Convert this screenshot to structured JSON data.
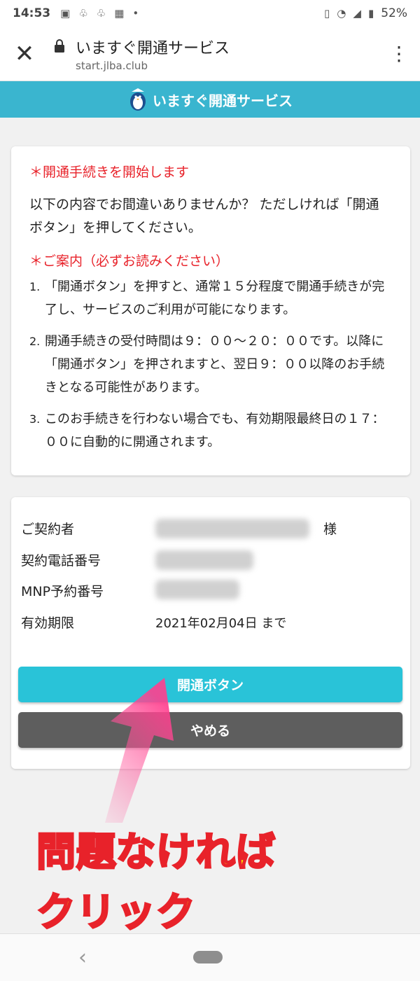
{
  "status_bar": {
    "time": "14:53",
    "dot": "•",
    "battery": "52%"
  },
  "browser": {
    "title": "いますぐ開通サービス",
    "url": "start.jlba.club"
  },
  "site_header": {
    "title": "いますぐ開通サービス"
  },
  "notice": {
    "heading": "＊開通手続きを開始します",
    "intro": "以下の内容でお間違いありませんか？ ただしければ「開通ボタン」を押してください。",
    "guide_heading": "＊ご案内（必ずお読みください）",
    "items": [
      {
        "num": "1.",
        "text": "「開通ボタン」を押すと、通常１５分程度で開通手続きが完了し、サービスのご利用が可能になります。"
      },
      {
        "num": "2.",
        "text": "開通手続きの受付時間は９：００～２０：００です。以降に「開通ボタン」を押されますと、翌日９：００以降のお手続きとなる可能性があります。"
      },
      {
        "num": "3.",
        "text": "このお手続きを行わない場合でも、有効期限最終日の１７：００に自動的に開通されます。"
      }
    ]
  },
  "contract": {
    "contractor_label": "ご契約者",
    "honorific": "様",
    "phone_label": "契約電話番号",
    "mnp_label": "MNP予約番号",
    "expiry_label": "有効期限",
    "expiry_value": "2021年02月04日 まで"
  },
  "buttons": {
    "activate": "開通ボタン",
    "cancel": "やめる"
  },
  "overlay": {
    "line1": "問題なければ",
    "line2": "クリック"
  },
  "colors": {
    "header": "#3ab5cf",
    "activate": "#29c3d8",
    "cancel": "#5e5e5e",
    "red": "#e8222a",
    "overlay_fill": "#ffee00"
  }
}
